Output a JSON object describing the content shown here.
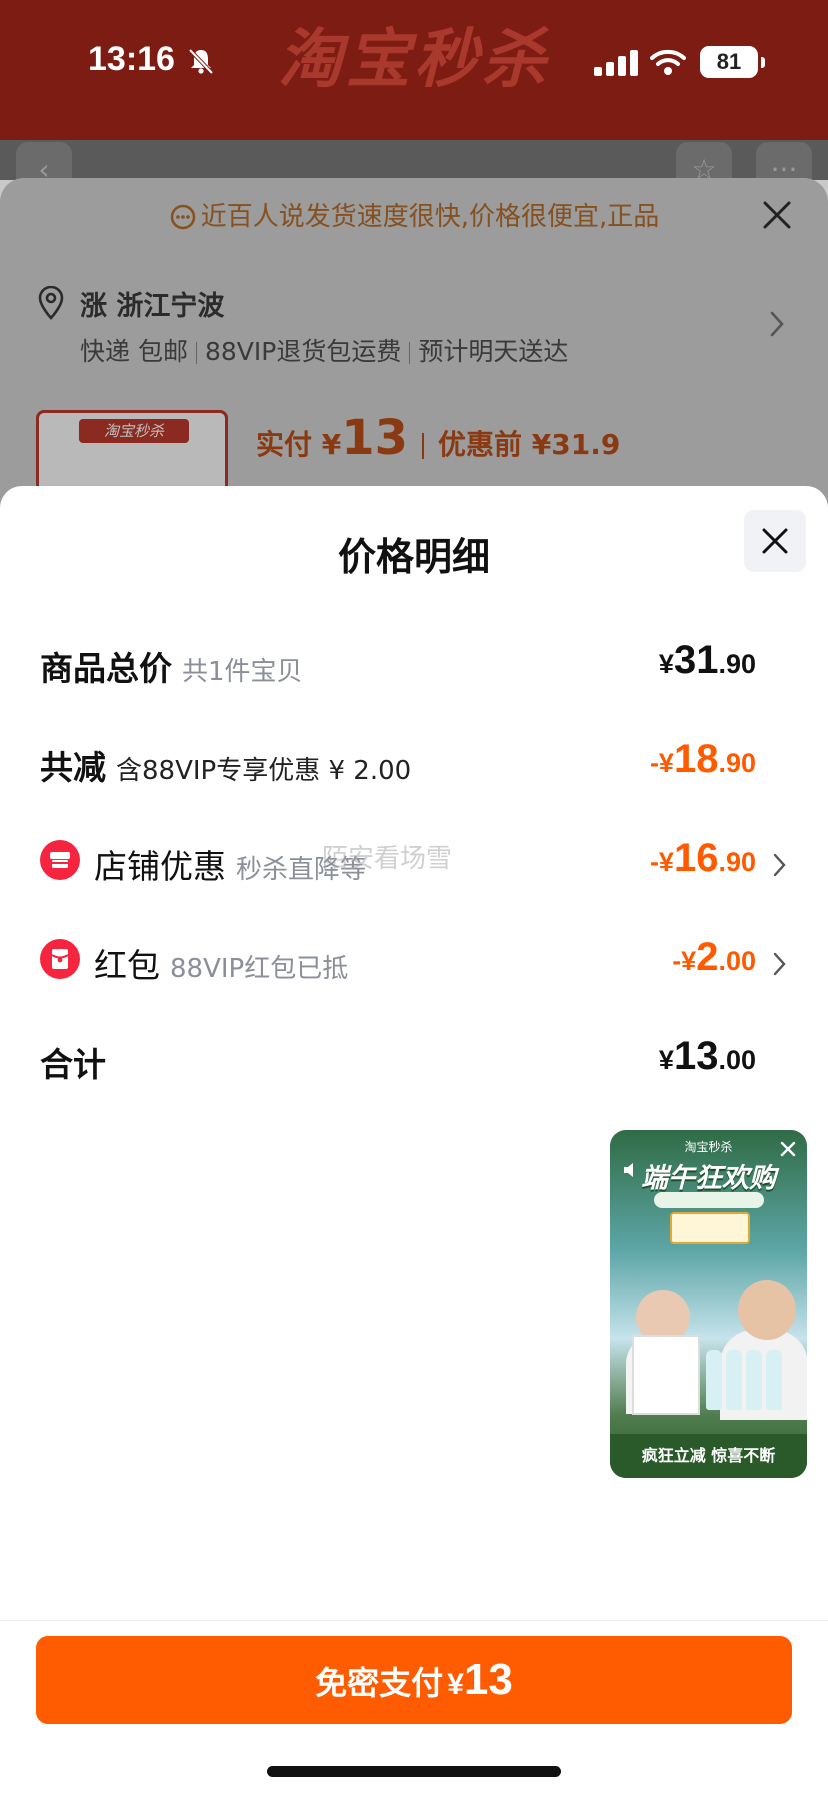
{
  "status_bar": {
    "time": "13:16",
    "battery": "81"
  },
  "background": {
    "banner_title": "淘宝秒杀",
    "hint": "近百人说发货速度很快,价格很便宜,正品",
    "location": "涨 浙江宁波",
    "shipping": [
      "快递 包邮",
      "88VIP退货包运费",
      "预计明天送达"
    ],
    "thumb_tag": "淘宝秒杀",
    "price": {
      "paid_label": "实付 ¥",
      "paid_amount": "13",
      "before_label": "优惠前 ¥31.9"
    }
  },
  "sheet": {
    "title": "价格明细",
    "rows": [
      {
        "label": "商品总价",
        "sub": "共1件宝贝",
        "sym": "¥",
        "int": "31",
        "dec": ".90"
      },
      {
        "label": "共减",
        "sub": "含88VIP专享优惠 ¥ 2.00",
        "sym": "-¥",
        "int": "18",
        "dec": ".90"
      },
      {
        "label": "店铺优惠",
        "sub": "秒杀直降等",
        "sym": "-¥",
        "int": "16",
        "dec": ".90"
      },
      {
        "label": "红包",
        "sub": "88VIP红包已抵",
        "sym": "-¥",
        "int": "2",
        "dec": ".00"
      },
      {
        "label": "合计",
        "sub": "",
        "sym": "¥",
        "int": "13",
        "dec": ".00"
      }
    ],
    "watermark": "陌安看场雪"
  },
  "video_card": {
    "logo": "淘宝秒杀",
    "title": "端午狂欢购",
    "bottom": "疯狂立减 惊喜不断"
  },
  "pay": {
    "label": "免密支付",
    "sym": "¥",
    "amount": "13"
  },
  "colors": {
    "accent": "#ff5b00",
    "discount": "#ff5a00",
    "icon_red": "#f5243f"
  }
}
